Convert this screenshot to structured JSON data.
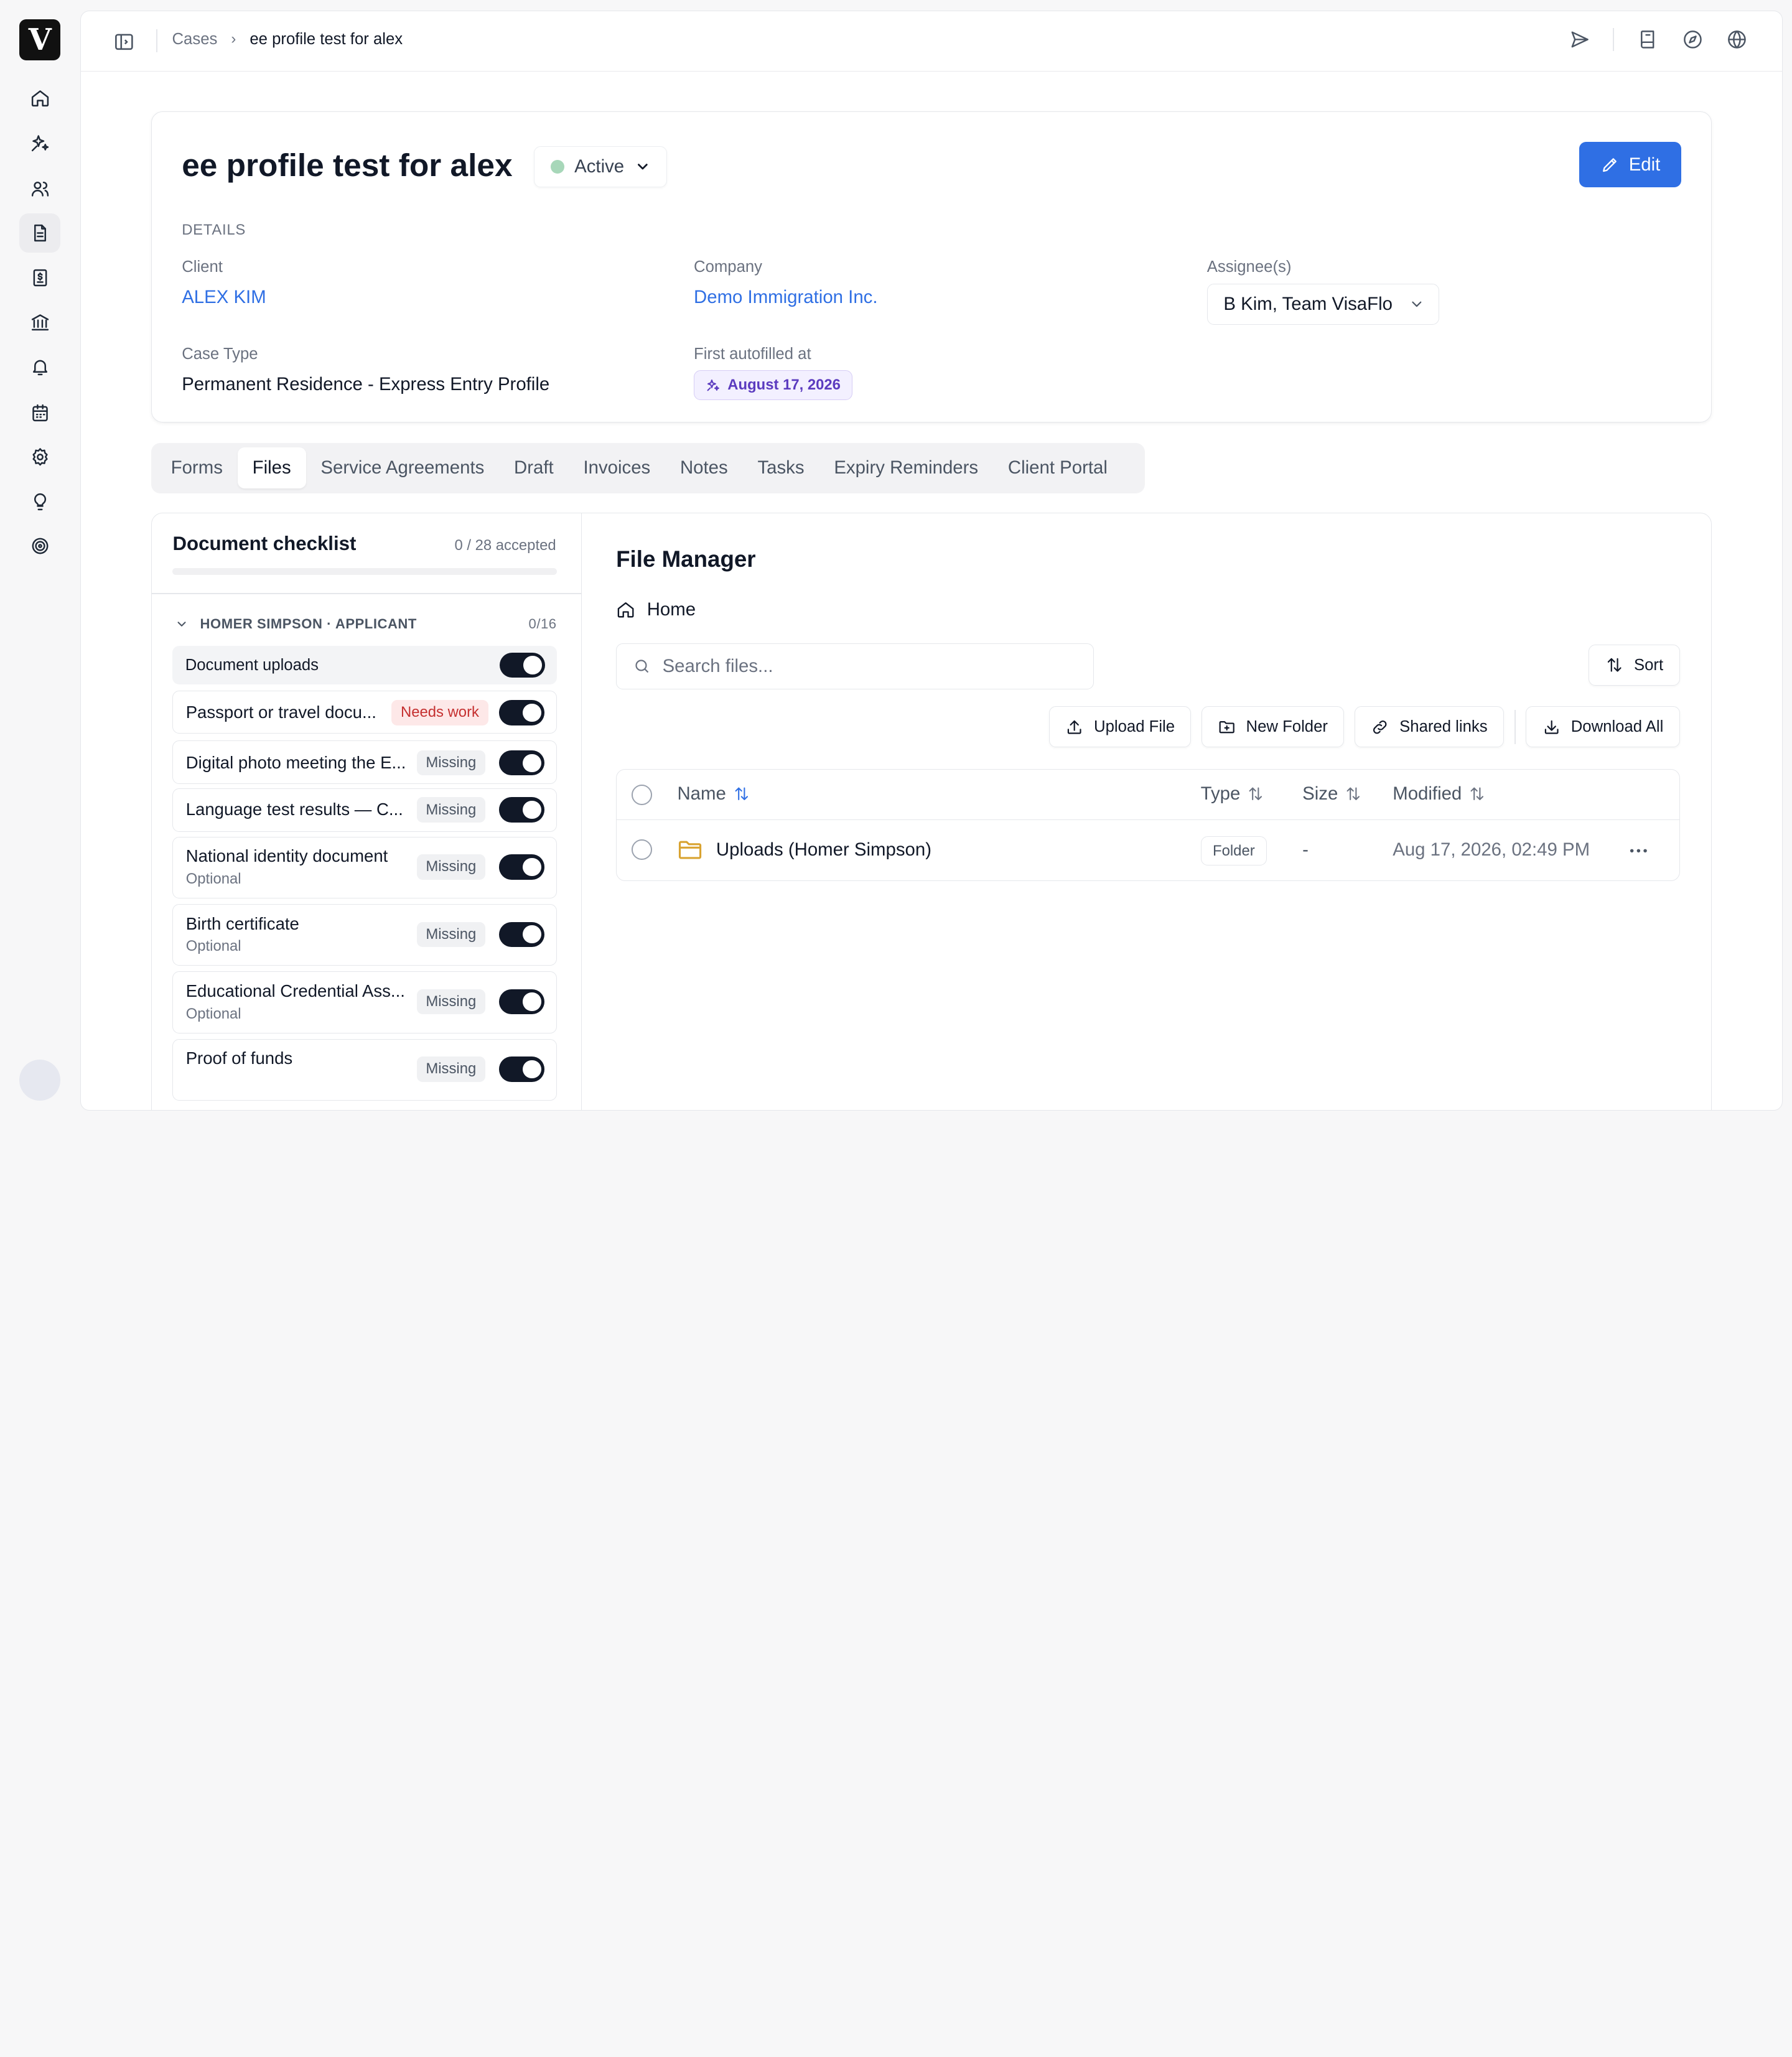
{
  "app": {
    "logo_letter": "V"
  },
  "breadcrumb": {
    "root": "Cases",
    "current": "ee profile test for alex"
  },
  "case": {
    "title": "ee profile test for alex",
    "status": "Active",
    "edit_label": "Edit",
    "details_label": "DETAILS",
    "client_label": "Client",
    "client_value": "ALEX KIM",
    "company_label": "Company",
    "company_value": "Demo Immigration Inc.",
    "assignee_label": "Assignee(s)",
    "assignee_value": "B Kim, Team VisaFlo",
    "case_type_label": "Case Type",
    "case_type_value": "Permanent Residence - Express Entry Profile",
    "autofilled_label": "First autofilled at",
    "autofilled_value": "August 17, 2026"
  },
  "tabs": [
    "Forms",
    "Files",
    "Service Agreements",
    "Draft",
    "Invoices",
    "Notes",
    "Tasks",
    "Expiry Reminders",
    "Client Portal"
  ],
  "active_tab": "Files",
  "checklist": {
    "title": "Document checklist",
    "count": "0 / 28 accepted",
    "progress": 0,
    "group_label": "HOMER SIMPSON · APPLICANT",
    "group_count": "0/16",
    "uploads_label": "Document uploads",
    "items": [
      {
        "name": "Passport or travel docu...",
        "badge": "Needs work",
        "optional": ""
      },
      {
        "name": "Digital photo meeting the E...",
        "badge": "Missing",
        "optional": ""
      },
      {
        "name": "Language test results — C...",
        "badge": "Missing",
        "optional": ""
      },
      {
        "name": "National identity document",
        "badge": "Missing",
        "optional": "Optional"
      },
      {
        "name": "Birth certificate",
        "badge": "Missing",
        "optional": "Optional"
      },
      {
        "name": "Educational Credential Ass...",
        "badge": "Missing",
        "optional": "Optional"
      },
      {
        "name": "Proof of funds",
        "badge": "Missing",
        "optional": ""
      }
    ]
  },
  "file_manager": {
    "title": "File Manager",
    "location": "Home",
    "search_placeholder": "Search files...",
    "sort_label": "Sort",
    "upload_label": "Upload File",
    "new_folder_label": "New Folder",
    "shared_links_label": "Shared links",
    "download_all_label": "Download All",
    "columns": {
      "name": "Name",
      "type": "Type",
      "size": "Size",
      "modified": "Modified"
    },
    "rows": [
      {
        "name": "Uploads (Homer Simpson)",
        "type": "Folder",
        "size": "-",
        "modified": "Aug 17, 2026, 02:49 PM"
      }
    ]
  },
  "colors": {
    "accent": "#2f6fe4",
    "status_dot": "#a7d7b9",
    "needs_work_bg": "#fde8e8",
    "needs_work_text": "#c53030",
    "folder_icon": "#d9a331"
  }
}
